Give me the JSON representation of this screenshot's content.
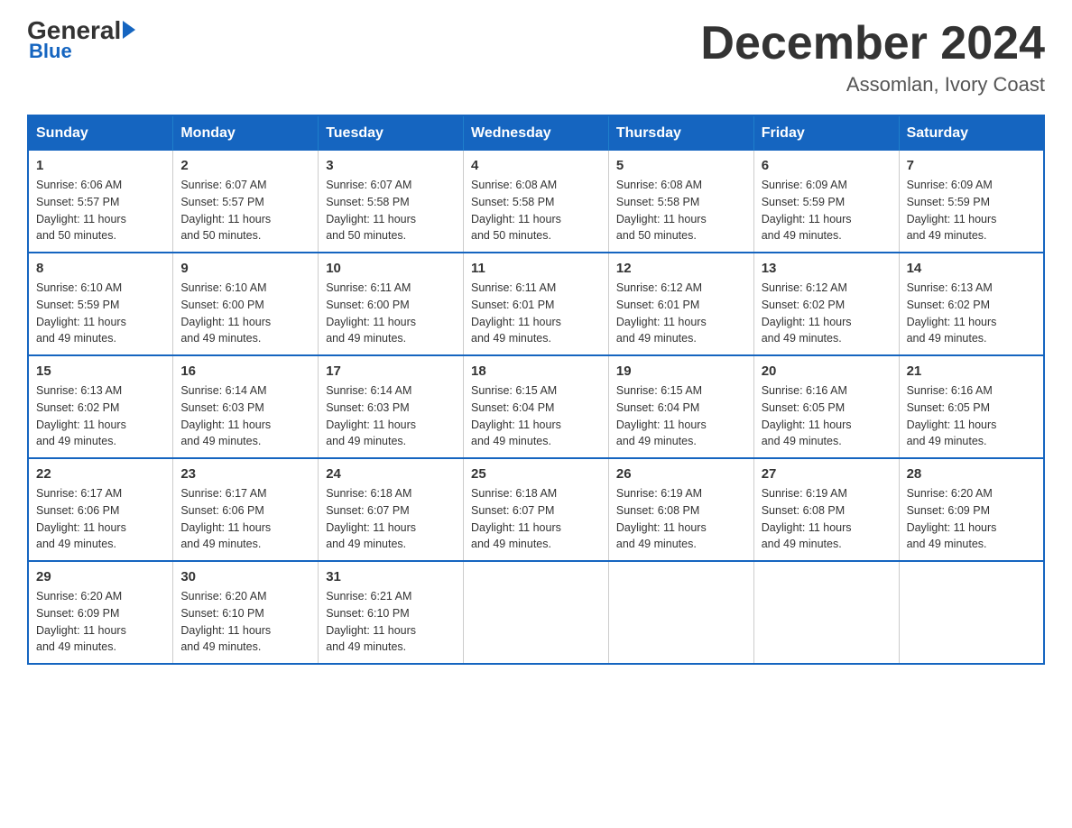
{
  "logo": {
    "general": "General",
    "triangle": "",
    "blue": "Blue"
  },
  "header": {
    "month_title": "December 2024",
    "location": "Assomlan, Ivory Coast"
  },
  "days_of_week": [
    "Sunday",
    "Monday",
    "Tuesday",
    "Wednesday",
    "Thursday",
    "Friday",
    "Saturday"
  ],
  "weeks": [
    {
      "days": [
        {
          "number": "1",
          "sunrise": "6:06 AM",
          "sunset": "5:57 PM",
          "daylight": "11 hours and 50 minutes."
        },
        {
          "number": "2",
          "sunrise": "6:07 AM",
          "sunset": "5:57 PM",
          "daylight": "11 hours and 50 minutes."
        },
        {
          "number": "3",
          "sunrise": "6:07 AM",
          "sunset": "5:58 PM",
          "daylight": "11 hours and 50 minutes."
        },
        {
          "number": "4",
          "sunrise": "6:08 AM",
          "sunset": "5:58 PM",
          "daylight": "11 hours and 50 minutes."
        },
        {
          "number": "5",
          "sunrise": "6:08 AM",
          "sunset": "5:58 PM",
          "daylight": "11 hours and 50 minutes."
        },
        {
          "number": "6",
          "sunrise": "6:09 AM",
          "sunset": "5:59 PM",
          "daylight": "11 hours and 49 minutes."
        },
        {
          "number": "7",
          "sunrise": "6:09 AM",
          "sunset": "5:59 PM",
          "daylight": "11 hours and 49 minutes."
        }
      ]
    },
    {
      "days": [
        {
          "number": "8",
          "sunrise": "6:10 AM",
          "sunset": "5:59 PM",
          "daylight": "11 hours and 49 minutes."
        },
        {
          "number": "9",
          "sunrise": "6:10 AM",
          "sunset": "6:00 PM",
          "daylight": "11 hours and 49 minutes."
        },
        {
          "number": "10",
          "sunrise": "6:11 AM",
          "sunset": "6:00 PM",
          "daylight": "11 hours and 49 minutes."
        },
        {
          "number": "11",
          "sunrise": "6:11 AM",
          "sunset": "6:01 PM",
          "daylight": "11 hours and 49 minutes."
        },
        {
          "number": "12",
          "sunrise": "6:12 AM",
          "sunset": "6:01 PM",
          "daylight": "11 hours and 49 minutes."
        },
        {
          "number": "13",
          "sunrise": "6:12 AM",
          "sunset": "6:02 PM",
          "daylight": "11 hours and 49 minutes."
        },
        {
          "number": "14",
          "sunrise": "6:13 AM",
          "sunset": "6:02 PM",
          "daylight": "11 hours and 49 minutes."
        }
      ]
    },
    {
      "days": [
        {
          "number": "15",
          "sunrise": "6:13 AM",
          "sunset": "6:02 PM",
          "daylight": "11 hours and 49 minutes."
        },
        {
          "number": "16",
          "sunrise": "6:14 AM",
          "sunset": "6:03 PM",
          "daylight": "11 hours and 49 minutes."
        },
        {
          "number": "17",
          "sunrise": "6:14 AM",
          "sunset": "6:03 PM",
          "daylight": "11 hours and 49 minutes."
        },
        {
          "number": "18",
          "sunrise": "6:15 AM",
          "sunset": "6:04 PM",
          "daylight": "11 hours and 49 minutes."
        },
        {
          "number": "19",
          "sunrise": "6:15 AM",
          "sunset": "6:04 PM",
          "daylight": "11 hours and 49 minutes."
        },
        {
          "number": "20",
          "sunrise": "6:16 AM",
          "sunset": "6:05 PM",
          "daylight": "11 hours and 49 minutes."
        },
        {
          "number": "21",
          "sunrise": "6:16 AM",
          "sunset": "6:05 PM",
          "daylight": "11 hours and 49 minutes."
        }
      ]
    },
    {
      "days": [
        {
          "number": "22",
          "sunrise": "6:17 AM",
          "sunset": "6:06 PM",
          "daylight": "11 hours and 49 minutes."
        },
        {
          "number": "23",
          "sunrise": "6:17 AM",
          "sunset": "6:06 PM",
          "daylight": "11 hours and 49 minutes."
        },
        {
          "number": "24",
          "sunrise": "6:18 AM",
          "sunset": "6:07 PM",
          "daylight": "11 hours and 49 minutes."
        },
        {
          "number": "25",
          "sunrise": "6:18 AM",
          "sunset": "6:07 PM",
          "daylight": "11 hours and 49 minutes."
        },
        {
          "number": "26",
          "sunrise": "6:19 AM",
          "sunset": "6:08 PM",
          "daylight": "11 hours and 49 minutes."
        },
        {
          "number": "27",
          "sunrise": "6:19 AM",
          "sunset": "6:08 PM",
          "daylight": "11 hours and 49 minutes."
        },
        {
          "number": "28",
          "sunrise": "6:20 AM",
          "sunset": "6:09 PM",
          "daylight": "11 hours and 49 minutes."
        }
      ]
    },
    {
      "days": [
        {
          "number": "29",
          "sunrise": "6:20 AM",
          "sunset": "6:09 PM",
          "daylight": "11 hours and 49 minutes."
        },
        {
          "number": "30",
          "sunrise": "6:20 AM",
          "sunset": "6:10 PM",
          "daylight": "11 hours and 49 minutes."
        },
        {
          "number": "31",
          "sunrise": "6:21 AM",
          "sunset": "6:10 PM",
          "daylight": "11 hours and 49 minutes."
        },
        null,
        null,
        null,
        null
      ]
    }
  ],
  "labels": {
    "sunrise_prefix": "Sunrise: ",
    "sunset_prefix": "Sunset: ",
    "daylight_prefix": "Daylight: "
  }
}
